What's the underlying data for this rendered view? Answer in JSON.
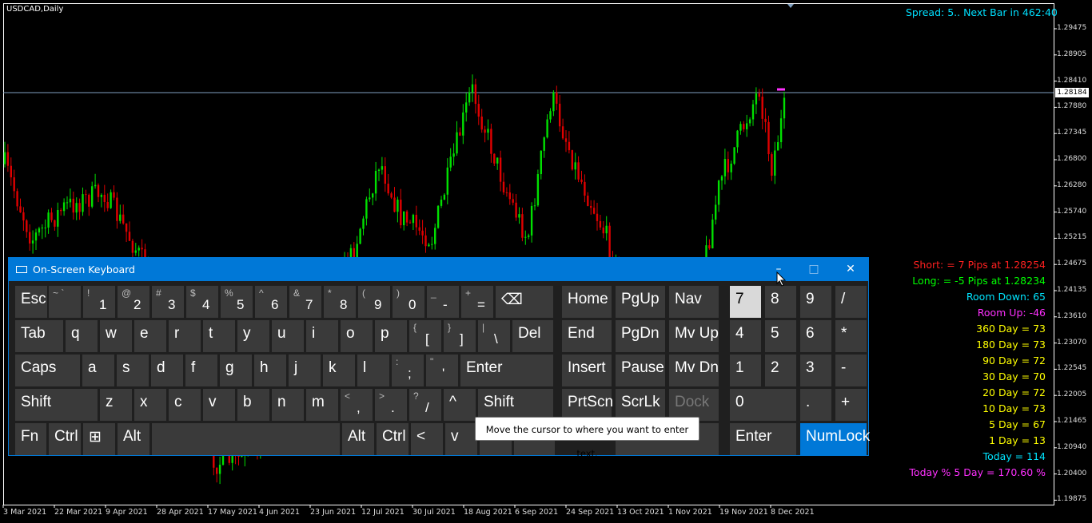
{
  "chart": {
    "symbol": "USDCAD,Daily",
    "spread_text": "Spread: 5.. Next Bar in 462:40",
    "current_price": "1.28184",
    "price_labels": [
      "1.29475",
      "1.28905",
      "1.28410",
      "1.27880",
      "1.27345",
      "1.26800",
      "1.26280",
      "1.25740",
      "1.25215",
      "1.24675",
      "1.24135",
      "1.23610",
      "1.23070",
      "1.22545",
      "1.22005",
      "1.21465",
      "1.20940",
      "1.20400",
      "1.19875"
    ],
    "date_labels": [
      "3 Mar 2021",
      "22 Mar 2021",
      "9 Apr 2021",
      "28 Apr 2021",
      "17 May 2021",
      "4 Jun 2021",
      "23 Jun 2021",
      "12 Jul 2021",
      "30 Jul 2021",
      "18 Aug 2021",
      "6 Sep 2021",
      "24 Sep 2021",
      "13 Oct 2021",
      "1 Nov 2021",
      "19 Nov 2021",
      "8 Dec 2021"
    ],
    "up_color": "#00e000",
    "down_color": "#e00000"
  },
  "stats": [
    {
      "text": "Short: = 7 Pips at 1.28254",
      "color": "#ff2020"
    },
    {
      "text": "Long: = -5 Pips at 1.28234",
      "color": "#00ff00"
    },
    {
      "text": "Room Down: 65",
      "color": "#00e5ff"
    },
    {
      "text": "Room Up: -46",
      "color": "#ff30ff"
    },
    {
      "text": "360 Day = 73",
      "color": "#ffff00"
    },
    {
      "text": "180 Day = 73",
      "color": "#ffff00"
    },
    {
      "text": "90 Day = 72",
      "color": "#ffff00"
    },
    {
      "text": "30 Day = 70",
      "color": "#ffff00"
    },
    {
      "text": "20 Day = 72",
      "color": "#ffff00"
    },
    {
      "text": "10 Day = 73",
      "color": "#ffff00"
    },
    {
      "text": "5 Day = 67",
      "color": "#ffff00"
    },
    {
      "text": "1 Day = 13",
      "color": "#ffff00"
    },
    {
      "text": "Today = 114",
      "color": "#00e5ff"
    },
    {
      "text": "Today % 5 Day = 170.60 %",
      "color": "#ff30ff"
    }
  ],
  "osk": {
    "title": "On-Screen Keyboard",
    "minimize": "–",
    "maximize": "□",
    "close": "✕",
    "tooltip": "Move the cursor to where you want to enter text.",
    "keys": [
      {
        "id": "esc",
        "label": "Esc"
      },
      {
        "id": "backtick",
        "top": "~ `",
        "main": ""
      },
      {
        "id": "1",
        "top": "!",
        "main": "1"
      },
      {
        "id": "2",
        "top": "@",
        "main": "2"
      },
      {
        "id": "3",
        "top": "#",
        "main": "3"
      },
      {
        "id": "4",
        "top": "$",
        "main": "4"
      },
      {
        "id": "5",
        "top": "%",
        "main": "5"
      },
      {
        "id": "6",
        "top": "^",
        "main": "6"
      },
      {
        "id": "7",
        "top": "&",
        "main": "7"
      },
      {
        "id": "8",
        "top": "*",
        "main": "8"
      },
      {
        "id": "9",
        "top": "(",
        "main": "9"
      },
      {
        "id": "0",
        "top": ")",
        "main": "0"
      },
      {
        "id": "minus",
        "top": "_",
        "main": "-"
      },
      {
        "id": "equals",
        "top": "+",
        "main": "="
      },
      {
        "id": "backspace",
        "label": "⌫"
      },
      {
        "id": "home",
        "label": "Home"
      },
      {
        "id": "pgup",
        "label": "PgUp"
      },
      {
        "id": "nav",
        "label": "Nav"
      },
      {
        "id": "np7",
        "label": "7"
      },
      {
        "id": "np8",
        "label": "8"
      },
      {
        "id": "np9",
        "label": "9"
      },
      {
        "id": "npdiv",
        "label": "/"
      },
      {
        "id": "tab",
        "label": "Tab"
      },
      {
        "id": "q",
        "label": "q"
      },
      {
        "id": "w",
        "label": "w"
      },
      {
        "id": "e",
        "label": "e"
      },
      {
        "id": "r",
        "label": "r"
      },
      {
        "id": "t",
        "label": "t"
      },
      {
        "id": "y",
        "label": "y"
      },
      {
        "id": "u",
        "label": "u"
      },
      {
        "id": "i",
        "label": "i"
      },
      {
        "id": "o",
        "label": "o"
      },
      {
        "id": "p",
        "label": "p"
      },
      {
        "id": "lbracket",
        "top": "{",
        "main": "["
      },
      {
        "id": "rbracket",
        "top": "}",
        "main": "]"
      },
      {
        "id": "backslash",
        "top": "|",
        "main": "\\"
      },
      {
        "id": "del",
        "label": "Del"
      },
      {
        "id": "end",
        "label": "End"
      },
      {
        "id": "pgdn",
        "label": "PgDn"
      },
      {
        "id": "mvup",
        "label": "Mv Up"
      },
      {
        "id": "np4",
        "label": "4"
      },
      {
        "id": "np5",
        "label": "5"
      },
      {
        "id": "np6",
        "label": "6"
      },
      {
        "id": "npmul",
        "label": "*"
      },
      {
        "id": "caps",
        "label": "Caps"
      },
      {
        "id": "a",
        "label": "a"
      },
      {
        "id": "s",
        "label": "s"
      },
      {
        "id": "d",
        "label": "d"
      },
      {
        "id": "f",
        "label": "f"
      },
      {
        "id": "g",
        "label": "g"
      },
      {
        "id": "h",
        "label": "h"
      },
      {
        "id": "j",
        "label": "j"
      },
      {
        "id": "k",
        "label": "k"
      },
      {
        "id": "l",
        "label": "l"
      },
      {
        "id": "semicolon",
        "top": ":",
        "main": ";"
      },
      {
        "id": "quote",
        "top": "\"",
        "main": "'"
      },
      {
        "id": "enter",
        "label": "Enter"
      },
      {
        "id": "insert",
        "label": "Insert"
      },
      {
        "id": "pause",
        "label": "Pause"
      },
      {
        "id": "mvdn",
        "label": "Mv Dn"
      },
      {
        "id": "np1",
        "label": "1"
      },
      {
        "id": "np2",
        "label": "2"
      },
      {
        "id": "np3",
        "label": "3"
      },
      {
        "id": "npminus",
        "label": "-"
      },
      {
        "id": "lshift",
        "label": "Shift"
      },
      {
        "id": "z",
        "label": "z"
      },
      {
        "id": "x",
        "label": "x"
      },
      {
        "id": "c",
        "label": "c"
      },
      {
        "id": "v",
        "label": "v"
      },
      {
        "id": "b",
        "label": "b"
      },
      {
        "id": "n",
        "label": "n"
      },
      {
        "id": "m",
        "label": "m"
      },
      {
        "id": "comma",
        "top": "<",
        "main": ","
      },
      {
        "id": "period",
        "top": ">",
        "main": "."
      },
      {
        "id": "slash",
        "top": "?",
        "main": "/"
      },
      {
        "id": "up",
        "label": "^"
      },
      {
        "id": "rshift",
        "label": "Shift"
      },
      {
        "id": "prtscn",
        "label": "PrtScn"
      },
      {
        "id": "scrlk",
        "label": "ScrLk"
      },
      {
        "id": "dock",
        "label": "Dock"
      },
      {
        "id": "np0",
        "label": "0"
      },
      {
        "id": "npdot",
        "label": "."
      },
      {
        "id": "npplus",
        "label": "+"
      },
      {
        "id": "fn",
        "label": "Fn"
      },
      {
        "id": "lctrl",
        "label": "Ctrl"
      },
      {
        "id": "win",
        "label": "⊞"
      },
      {
        "id": "lalt",
        "label": "Alt"
      },
      {
        "id": "space",
        "label": ""
      },
      {
        "id": "ralt",
        "label": "Alt"
      },
      {
        "id": "rctrl",
        "label": "Ctrl"
      },
      {
        "id": "left",
        "label": "<"
      },
      {
        "id": "down",
        "label": "v"
      },
      {
        "id": "right",
        "label": ">"
      },
      {
        "id": "menu",
        "label": ""
      },
      {
        "id": "fade",
        "label": "e"
      },
      {
        "id": "npenter",
        "label": "Enter"
      },
      {
        "id": "numlock",
        "label": "NumLock"
      }
    ]
  }
}
